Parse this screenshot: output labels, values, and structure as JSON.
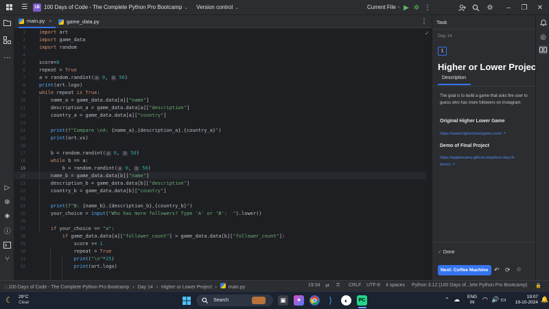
{
  "titlebar": {
    "project_badge": "1B",
    "project_name": "100 Days of Code - The Complete Python Pro Bootcamp",
    "vcs": "Version control",
    "run_config": "Current File"
  },
  "tabs": [
    {
      "label": "main.py"
    },
    {
      "label": "game_data.py"
    }
  ],
  "editor": {
    "lines": [
      {
        "n": "1",
        "segs": [
          [
            "kw",
            "import"
          ],
          [
            "t",
            " art"
          ]
        ]
      },
      {
        "n": "2",
        "segs": [
          [
            "kw",
            "import"
          ],
          [
            "t",
            " game_data"
          ]
        ]
      },
      {
        "n": "3",
        "segs": [
          [
            "kw",
            "import"
          ],
          [
            "t",
            " random"
          ]
        ]
      },
      {
        "n": "4",
        "segs": []
      },
      {
        "n": "5",
        "segs": [
          [
            "t",
            "score"
          ],
          [
            "op",
            "="
          ],
          [
            "num",
            "0"
          ]
        ]
      },
      {
        "n": "6",
        "segs": [
          [
            "t",
            "repeat = "
          ],
          [
            "kw",
            "True"
          ]
        ]
      },
      {
        "n": "7",
        "segs": [
          [
            "t",
            "a = random.randint("
          ],
          [
            "hint",
            "a"
          ],
          [
            "num",
            " 0"
          ],
          [
            "t",
            ", "
          ],
          [
            "hint",
            "b"
          ],
          [
            "num",
            " 50"
          ],
          [
            "t",
            ")"
          ]
        ]
      },
      {
        "n": "8",
        "segs": [
          [
            "fn",
            "print"
          ],
          [
            "t",
            "(art.logo)"
          ]
        ]
      },
      {
        "n": "9",
        "segs": [
          [
            "kw",
            "while"
          ],
          [
            "t",
            " repeat "
          ],
          [
            "kw",
            "is True"
          ],
          [
            "t",
            ":"
          ]
        ]
      },
      {
        "n": "10",
        "segs": [
          [
            "t",
            "    name_a = game_data.data[a]["
          ],
          [
            "str",
            "\"name\""
          ],
          [
            "t",
            "]"
          ]
        ]
      },
      {
        "n": "11",
        "segs": [
          [
            "t",
            "    description_a = game_data.data[a]["
          ],
          [
            "str",
            "\"description\""
          ],
          [
            "t",
            "]"
          ]
        ]
      },
      {
        "n": "12",
        "segs": [
          [
            "t",
            "    country_a = game_data.data[a]["
          ],
          [
            "str",
            "\"country\""
          ],
          [
            "t",
            "]"
          ]
        ]
      },
      {
        "n": "13",
        "segs": []
      },
      {
        "n": "14",
        "segs": [
          [
            "fn",
            "    print"
          ],
          [
            "t",
            "("
          ],
          [
            "str",
            "f\"Compare \\nA: "
          ],
          [
            "t",
            "{name_a}"
          ],
          [
            "str",
            ","
          ],
          [
            "t",
            "{description_a}"
          ],
          [
            "str",
            ","
          ],
          [
            "t",
            "{country_a}"
          ],
          [
            "str",
            "\""
          ],
          [
            "t",
            ")"
          ]
        ]
      },
      {
        "n": "15",
        "segs": [
          [
            "fn",
            "    print"
          ],
          [
            "t",
            "(art.vs)"
          ]
        ]
      },
      {
        "n": "16",
        "segs": []
      },
      {
        "n": "17",
        "segs": [
          [
            "t",
            "    b = random.randint("
          ],
          [
            "hint",
            "a"
          ],
          [
            "num",
            " 0"
          ],
          [
            "t",
            ", "
          ],
          [
            "hint",
            "b"
          ],
          [
            "num",
            " 50"
          ],
          [
            "t",
            ")"
          ]
        ]
      },
      {
        "n": "18",
        "segs": [
          [
            "kw",
            "    while"
          ],
          [
            "t",
            " b == a:"
          ]
        ]
      },
      {
        "n": "19",
        "segs": [
          [
            "t",
            "        b = random.randint("
          ],
          [
            "hint",
            "a"
          ],
          [
            "num",
            " 0"
          ],
          [
            "t",
            ", "
          ],
          [
            "hint",
            "b"
          ],
          [
            "num",
            " 50"
          ],
          [
            "t",
            ")"
          ]
        ]
      },
      {
        "n": "20",
        "segs": [
          [
            "t",
            "    name_b = game_data.data[b]["
          ],
          [
            "str",
            "\"name\""
          ],
          [
            "t",
            "]"
          ]
        ]
      },
      {
        "n": "21",
        "segs": [
          [
            "t",
            "    description_b = game_data.data[b]["
          ],
          [
            "str",
            "\"description\""
          ],
          [
            "t",
            "]"
          ]
        ]
      },
      {
        "n": "22",
        "segs": [
          [
            "t",
            "    country_b = game_data.data[b]["
          ],
          [
            "str",
            "\"country\""
          ],
          [
            "t",
            "]"
          ]
        ]
      },
      {
        "n": "23",
        "segs": []
      },
      {
        "n": "24",
        "segs": [
          [
            "fn",
            "    print"
          ],
          [
            "t",
            "("
          ],
          [
            "str",
            "f\"B: "
          ],
          [
            "t",
            "{name_b}"
          ],
          [
            "str",
            ","
          ],
          [
            "t",
            "{description_b}"
          ],
          [
            "str",
            ","
          ],
          [
            "t",
            "{country_b}"
          ],
          [
            "str",
            "\""
          ],
          [
            "t",
            ")"
          ]
        ]
      },
      {
        "n": "25",
        "segs": [
          [
            "t",
            "    your_choice = "
          ],
          [
            "fn",
            "input"
          ],
          [
            "t",
            "("
          ],
          [
            "str",
            "\"Who has more followers? Type 'A' or 'B':  \""
          ],
          [
            "t",
            ").lower()"
          ]
        ]
      },
      {
        "n": "26",
        "segs": []
      },
      {
        "n": "27",
        "segs": [
          [
            "kw",
            "    if"
          ],
          [
            "t",
            " your_choice == "
          ],
          [
            "str",
            "\"a\""
          ],
          [
            "t",
            ":"
          ]
        ]
      },
      {
        "n": "28",
        "segs": [
          [
            "kw",
            "        if"
          ],
          [
            "t",
            " game_data.data[a]["
          ],
          [
            "str",
            "\"follower_count\""
          ],
          [
            "t",
            "] > game_data.data[b]["
          ],
          [
            "str",
            "\"follower_count\""
          ],
          [
            "t",
            "]:"
          ]
        ]
      },
      {
        "n": "29",
        "segs": [
          [
            "t",
            "            score += "
          ],
          [
            "num",
            "1"
          ]
        ]
      },
      {
        "n": "30",
        "segs": [
          [
            "t",
            "            repeat = "
          ],
          [
            "kw",
            "True"
          ]
        ]
      },
      {
        "n": "31",
        "segs": [
          [
            "fn",
            "            print"
          ],
          [
            "t",
            "("
          ],
          [
            "str",
            "\"\\n\""
          ],
          [
            "t",
            "*"
          ],
          [
            "num",
            "25"
          ],
          [
            "t",
            ")"
          ]
        ]
      },
      {
        "n": "32",
        "segs": [
          [
            "fn",
            "            print"
          ],
          [
            "t",
            "(art.logo)"
          ]
        ]
      }
    ]
  },
  "task_panel": {
    "header": "Task",
    "day": "Day 14",
    "step": "1",
    "title": "Higher or Lower Project",
    "tab": "Description",
    "description": "The goal is to build a game that asks the user to guess who has more followers on Instagram.",
    "section1": "Original Higher Lower Game",
    "link1": "https://www.higherlowergame.com/",
    "section2": "Demo of Final Project",
    "link2": "https://appbrewery.github.io/python-day14-demo/",
    "done": "Done",
    "next_button": "Next: Coffee Machine"
  },
  "statusbar": {
    "breadcrumbs": [
      "100 Days of Code - The Complete Python Pro Bootcamp",
      "Day 14",
      "Higher or Lower Project",
      "main.py"
    ],
    "position": "19:34",
    "line_sep": "CRLF",
    "encoding": "UTF-8",
    "indent": "4 spaces",
    "interpreter": "Python 3.12 (100 Days of...lete Python Pro Bootcamp)"
  },
  "taskbar": {
    "weather_temp": "29°C",
    "weather_desc": "Clear",
    "search": "Search",
    "lang1": "ENG",
    "lang2": "IN",
    "time": "19:07",
    "date": "19-10-2024"
  },
  "colors": {
    "accent": "#3574f0",
    "keyword": "#cf8e6d",
    "string": "#6aab73",
    "number": "#2aacb8",
    "function": "#56a8f5"
  }
}
